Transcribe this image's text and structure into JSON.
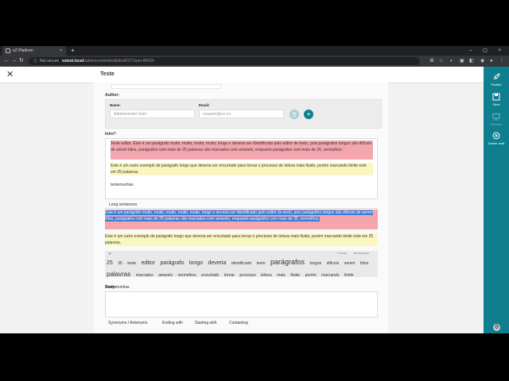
{
  "browser": {
    "tab_title": "eZ Platform",
    "tab_close": "×",
    "new_tab": "+",
    "window_controls": "– ▢ ×",
    "not_secure": "Not secure",
    "url_host": "eztest.local",
    "url_path": "/admin/content/edit/draft/37/1/por-BR/26"
  },
  "topbar": {
    "title": "Teste"
  },
  "rail": {
    "publish": "Publish",
    "save": "Save",
    "preview": "Preview",
    "delete_draft": "Delete draft"
  },
  "author": {
    "label": "Author:",
    "name_label": "Name:",
    "name_value": "Administrator User",
    "email_label": "Email:",
    "email_value": "nospam@ez.no"
  },
  "intro": {
    "label": "Intro*:",
    "p1": "Teste editor. Este é um parágrafo muito, muito, muito, muito, longo e deveria ser identificado pelo editor de texto, pois parágrafos longos são difíceis de serem lidos, parágrafos com mais de 25 palavras são marcados com amarelo, enquanto parágrafos com mais de 35, vermelhos.",
    "p2": "Este é um outro exemplo de parágrafo longo que deveria ser encurtado para tornar o processo de leitura mais fluido, porém marcando limite este em 25 palavras.",
    "p3": "testemunhas"
  },
  "analysis": {
    "tab": "Long sentences",
    "s1": "Este é um parágrafo muito, muito, muito, muito, muito, longo e deveria ser identificado pelo editor de texto, pois parágrafos longos são difíceis de serem lidos, parágrafos com mais de 25 palavras são marcados com amarelo, enquanto parágrafos com mais de 35, vermelhos.",
    "s2": "Este é um outro exemplo de parágrafo longo que deveria ser encurtado para tornar o processo de leitura mais fluido, porém marcando limite este em 25 palavras."
  },
  "cloud": {
    "p_label": "P",
    "words_count": "71 words",
    "chars_count": "434 characters",
    "words": [
      {
        "t": "25",
        "s": 7
      },
      {
        "t": "35",
        "s": 5
      },
      {
        "t": "teste",
        "s": 5
      },
      {
        "t": "editor",
        "s": 7
      },
      {
        "t": "parágrafo",
        "s": 7
      },
      {
        "t": "longo",
        "s": 7
      },
      {
        "t": "deveria",
        "s": 7
      },
      {
        "t": "identificado",
        "s": 5
      },
      {
        "t": "texto",
        "s": 5
      },
      {
        "t": "parágrafos",
        "s": 9
      },
      {
        "t": "longos",
        "s": 5
      },
      {
        "t": "difíceis",
        "s": 5
      },
      {
        "t": "serem",
        "s": 5
      },
      {
        "t": "lidos",
        "s": 5
      },
      {
        "t": "palavras",
        "s": 8
      },
      {
        "t": "marcados",
        "s": 5
      },
      {
        "t": "amarelo",
        "s": 5
      },
      {
        "t": "vermelhos",
        "s": 5
      },
      {
        "t": "encurtado",
        "s": 5
      },
      {
        "t": "tornar",
        "s": 5
      },
      {
        "t": "processo",
        "s": 5
      },
      {
        "t": "leitura",
        "s": 5
      },
      {
        "t": "mais",
        "s": 5
      },
      {
        "t": "fluido",
        "s": 5
      },
      {
        "t": "porém",
        "s": 5
      },
      {
        "t": "marcando",
        "s": 5
      },
      {
        "t": "limite",
        "s": 5
      },
      {
        "t": "testemunhas",
        "s": 5
      }
    ]
  },
  "body": {
    "label": "Body:",
    "tabs": [
      "Synonyms / Antonyms",
      "Ending with",
      "Starting with",
      "Containing"
    ]
  },
  "colors": {
    "accent": "#0f7f8f",
    "red_highlight": "#f5a5ad",
    "yellow_highlight": "#fbf6c0",
    "selection": "#3a7bd5"
  }
}
